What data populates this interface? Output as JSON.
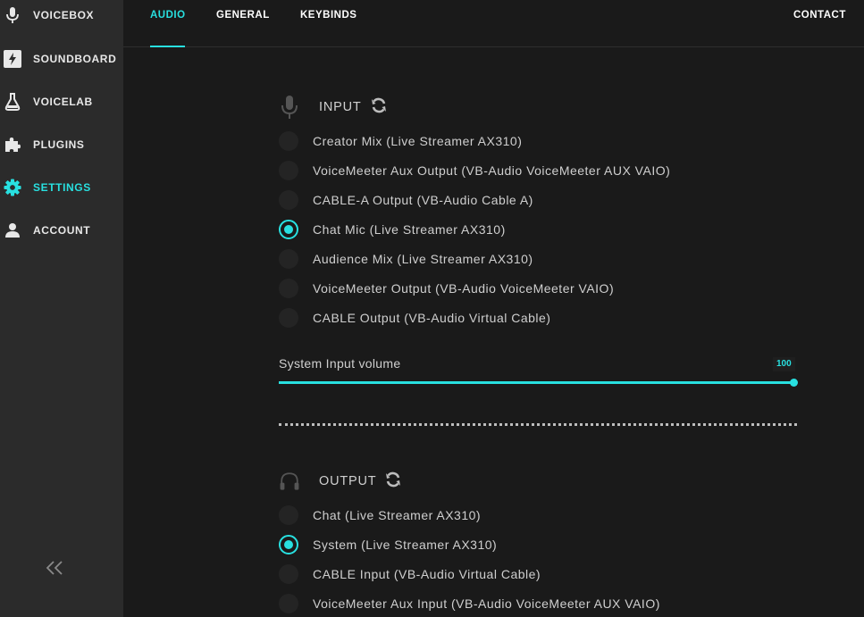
{
  "sidebar": {
    "items": [
      {
        "label": "VOICEBOX",
        "icon": "microphone-icon"
      },
      {
        "label": "SOUNDBOARD",
        "icon": "lightning-icon"
      },
      {
        "label": "VOICELAB",
        "icon": "flask-icon"
      },
      {
        "label": "PLUGINS",
        "icon": "puzzle-icon"
      },
      {
        "label": "SETTINGS",
        "icon": "gear-icon"
      },
      {
        "label": "ACCOUNT",
        "icon": "user-icon"
      }
    ],
    "active": "SETTINGS",
    "collapse_icon": "double-chevron-left-icon"
  },
  "tabs": [
    {
      "label": "AUDIO"
    },
    {
      "label": "GENERAL"
    },
    {
      "label": "KEYBINDS"
    },
    {
      "label": "CONTACT"
    }
  ],
  "active_tab": "AUDIO",
  "input": {
    "title": "INPUT",
    "devices": [
      {
        "label": "Creator Mix (Live Streamer AX310)",
        "selected": false
      },
      {
        "label": "VoiceMeeter Aux Output (VB-Audio VoiceMeeter AUX VAIO)",
        "selected": false
      },
      {
        "label": "CABLE-A Output (VB-Audio Cable A)",
        "selected": false
      },
      {
        "label": "Chat Mic (Live Streamer AX310)",
        "selected": true
      },
      {
        "label": "Audience Mix (Live Streamer AX310)",
        "selected": false
      },
      {
        "label": "VoiceMeeter Output (VB-Audio VoiceMeeter VAIO)",
        "selected": false
      },
      {
        "label": "CABLE Output (VB-Audio Virtual Cable)",
        "selected": false
      }
    ],
    "volume_label": "System Input volume",
    "volume_value": "100",
    "volume_fraction": 1.0
  },
  "output": {
    "title": "OUTPUT",
    "devices": [
      {
        "label": "Chat (Live Streamer AX310)",
        "selected": false
      },
      {
        "label": "System (Live Streamer AX310)",
        "selected": true
      },
      {
        "label": "CABLE Input (VB-Audio Virtual Cable)",
        "selected": false
      },
      {
        "label": "VoiceMeeter Aux Input (VB-Audio VoiceMeeter AUX VAIO)",
        "selected": false
      }
    ]
  },
  "colors": {
    "accent": "#28e0e0",
    "sidebar_bg": "#2b2b2b",
    "main_bg": "#1a1a1a"
  }
}
